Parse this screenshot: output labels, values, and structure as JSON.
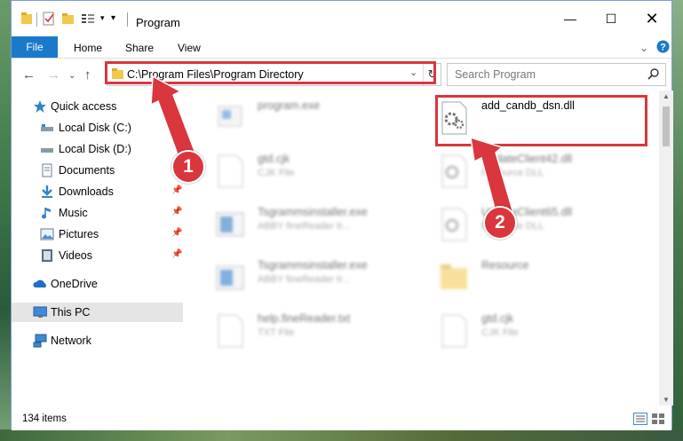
{
  "window": {
    "title": "Program"
  },
  "ribbon": {
    "tabs": [
      "File",
      "Home",
      "Share",
      "View"
    ]
  },
  "address": {
    "path": "C:\\Program Files\\Program Directory"
  },
  "search": {
    "placeholder": "Search Program"
  },
  "sidebar": {
    "items": [
      {
        "label": "Quick access",
        "icon": "star-icon"
      },
      {
        "label": "Local Disk (C:)",
        "icon": "drive-icon"
      },
      {
        "label": "Local Disk (D:)",
        "icon": "drive-icon"
      },
      {
        "label": "Documents",
        "icon": "documents-icon"
      },
      {
        "label": "Downloads",
        "icon": "download-icon"
      },
      {
        "label": "Music",
        "icon": "music-icon"
      },
      {
        "label": "Pictures",
        "icon": "pictures-icon"
      },
      {
        "label": "Videos",
        "icon": "videos-icon"
      },
      {
        "label": "OneDrive",
        "icon": "cloud-icon"
      },
      {
        "label": "This PC",
        "icon": "computer-icon"
      },
      {
        "label": "Network",
        "icon": "network-icon"
      }
    ]
  },
  "files": [
    {
      "name": "program.exe",
      "type": ""
    },
    {
      "name": "add_candb_dsn.dll",
      "type": ""
    },
    {
      "name": "gtd.cjk",
      "type": "CJK File"
    },
    {
      "name": "UpdateClient42.dll",
      "type": "Resource DLL"
    },
    {
      "name": "Tsgrammsinstaller.exe",
      "type": "ABBY fineReader tr..."
    },
    {
      "name": "UpdateClient65.dll",
      "type": "Resource DLL"
    },
    {
      "name": "Tsgrammsinstaller.exe",
      "type": "ABBY fineReader tr..."
    },
    {
      "name": "Resource",
      "type": ""
    },
    {
      "name": "help.fineReader.txt",
      "type": "TXT File"
    },
    {
      "name": "gtd.cjk",
      "type": "CJK File"
    }
  ],
  "status": {
    "count": "134 items"
  },
  "callouts": [
    "1",
    "2"
  ],
  "colors": {
    "accent": "#1979ca",
    "highlight": "#d9363e"
  }
}
